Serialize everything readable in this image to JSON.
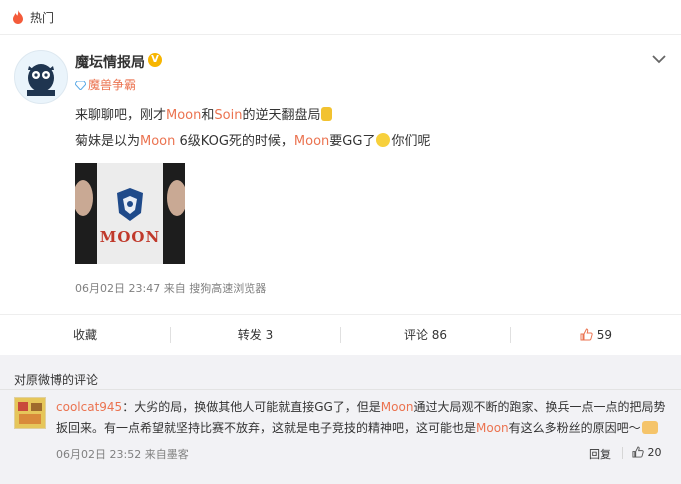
{
  "hot": {
    "label": "热门"
  },
  "post": {
    "author": "魔坛情报局",
    "source": "魔兽争霸",
    "line1": [
      "来聊聊吧，刚才",
      "Moon",
      "和",
      "Soin",
      "的逆天翻盘局"
    ],
    "line2": [
      "菊妹是以为",
      "Moon",
      " 6级KOG死的时候，",
      "Moon",
      "要GG了",
      "你们呢"
    ],
    "image_text": "MOON",
    "timestamp": "06月02日 23:47",
    "client": "来自 搜狗高速浏览器"
  },
  "actions": {
    "favorite": "收藏",
    "repost": "转发 3",
    "comment": "评论 86",
    "likes": "59"
  },
  "comments": {
    "header": "对原微博的评论",
    "items": [
      {
        "user": "coolcat945",
        "text_parts": [
          "：大劣的局，换做其他人可能就直接GG了，但是",
          "Moon",
          "通过大局观不断的跑家、换兵一点一点的把局势扳回来。有一点希望就坚持比赛不放弃，这就是电子竞技的精神吧，这可能也是",
          "Moon",
          "有这么多粉丝的原因吧～"
        ],
        "time": "06月02日 23:52",
        "client": "来自墨客",
        "reply": "回复",
        "likes": "20"
      }
    ]
  },
  "colors": {
    "accent": "#eb7350",
    "vbadge": "#f7b500"
  },
  "icons": [
    "flame-icon",
    "verified-badge-icon",
    "chevron-down-icon",
    "diamond-icon",
    "thumbs-up-icon",
    "comment-icon",
    "repost-icon"
  ]
}
